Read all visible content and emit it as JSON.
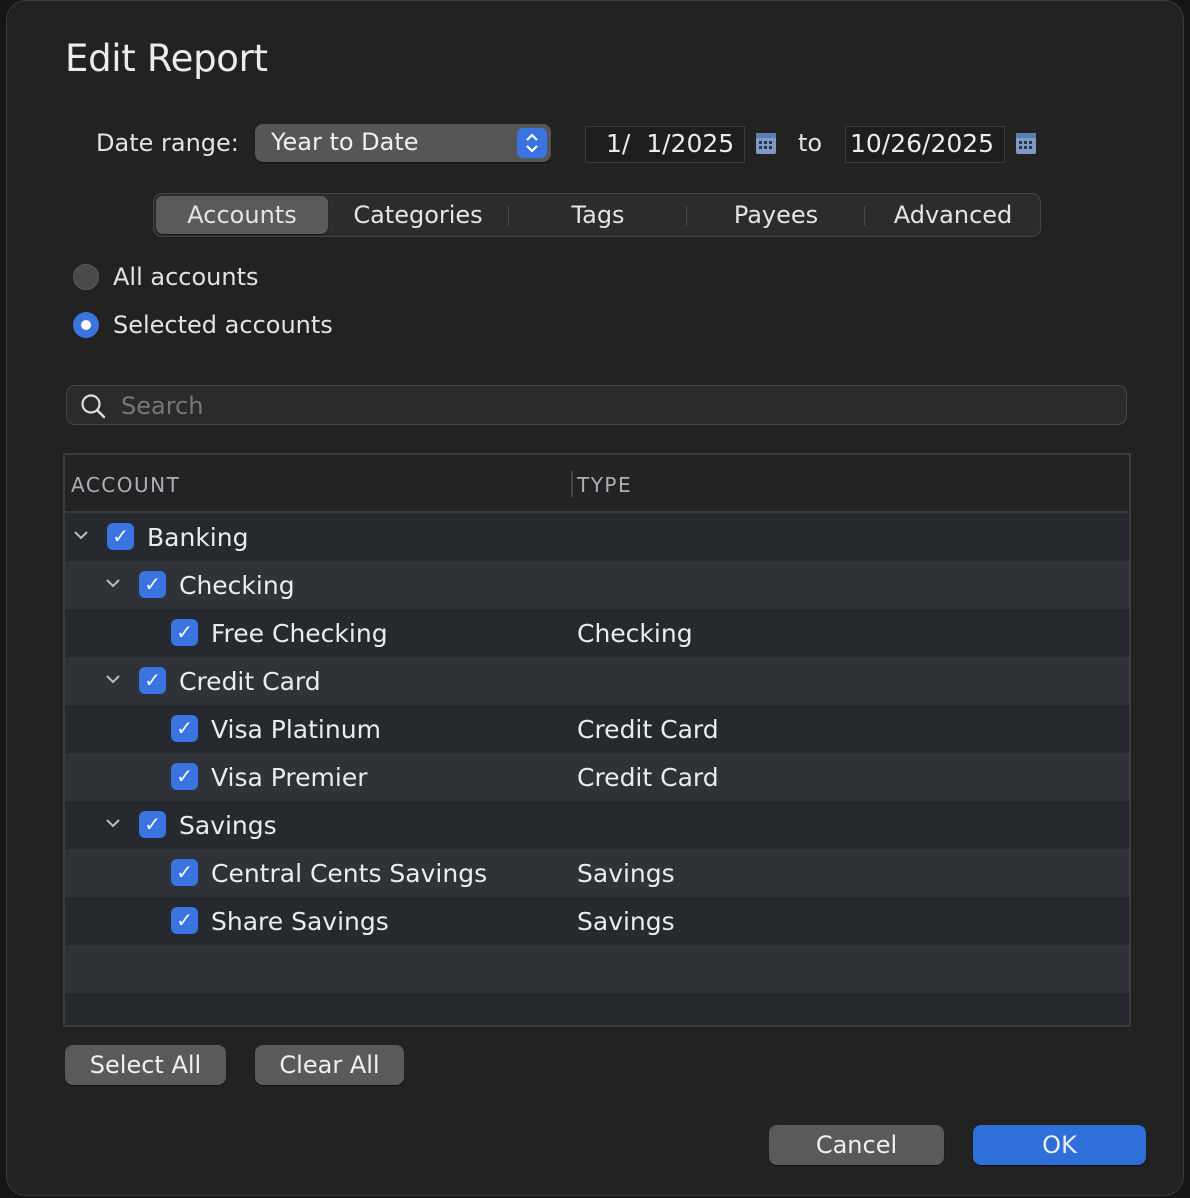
{
  "dialog": {
    "title": "Edit Report"
  },
  "date_range": {
    "label": "Date range:",
    "selected": "Year to Date",
    "start": "1/  1/2025",
    "separator": "to",
    "end": "10/26/2025"
  },
  "tabs": [
    {
      "label": "Accounts",
      "active": true
    },
    {
      "label": "Categories"
    },
    {
      "label": "Tags"
    },
    {
      "label": "Payees"
    },
    {
      "label": "Advanced"
    }
  ],
  "scope": {
    "all_label": "All accounts",
    "selected_label": "Selected accounts",
    "selected": "selected"
  },
  "search": {
    "placeholder": "Search",
    "value": ""
  },
  "table": {
    "headers": {
      "account": "ACCOUNT",
      "type": "TYPE"
    },
    "rows": [
      {
        "name": "Banking",
        "type": "",
        "level": 0,
        "expanded": true,
        "checked": true
      },
      {
        "name": "Checking",
        "type": "",
        "level": 1,
        "expanded": true,
        "checked": true
      },
      {
        "name": "Free Checking",
        "type": "Checking",
        "level": 2,
        "checked": true
      },
      {
        "name": "Credit Card",
        "type": "",
        "level": 1,
        "expanded": true,
        "checked": true
      },
      {
        "name": "Visa Platinum",
        "type": "Credit Card",
        "level": 2,
        "checked": true
      },
      {
        "name": "Visa Premier",
        "type": "Credit Card",
        "level": 2,
        "checked": true
      },
      {
        "name": "Savings",
        "type": "",
        "level": 1,
        "expanded": true,
        "checked": true
      },
      {
        "name": "Central Cents Savings",
        "type": "Savings",
        "level": 2,
        "checked": true
      },
      {
        "name": "Share Savings",
        "type": "Savings",
        "level": 2,
        "checked": true
      }
    ]
  },
  "buttons": {
    "select_all": "Select All",
    "clear_all": "Clear All",
    "cancel": "Cancel",
    "ok": "OK"
  },
  "colors": {
    "accent": "#3b73e0",
    "background": "#222222"
  }
}
